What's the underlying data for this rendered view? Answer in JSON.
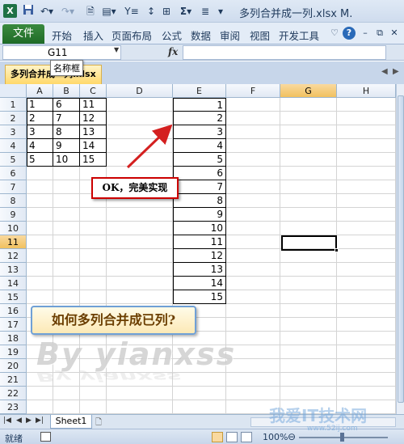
{
  "title_bar": {
    "app_icon": "X",
    "save_icon": "save-icon",
    "undo_icon": "undo-icon",
    "redo_icon": "redo-icon",
    "title": "多列合并成一列.xlsx M."
  },
  "ribbon": {
    "file_tab": "文件",
    "tabs": [
      "开始",
      "插入",
      "页面布局",
      "公式",
      "数据",
      "审阅",
      "视图",
      "开发工具"
    ],
    "help_icon": "?"
  },
  "formula_bar": {
    "name_box_value": "G11",
    "fx_label": "fx",
    "formula_value": "",
    "tooltip": "名称框"
  },
  "workbook_tab": {
    "name": "多列合并成一列.xlsx"
  },
  "grid": {
    "columns": [
      "A",
      "B",
      "C",
      "D",
      "E",
      "F",
      "G",
      "H"
    ],
    "rows": [
      "1",
      "2",
      "3",
      "4",
      "5",
      "6",
      "7",
      "8",
      "9",
      "10",
      "11",
      "12",
      "13",
      "14",
      "15",
      "16",
      "17",
      "18",
      "19",
      "20",
      "21",
      "22",
      "23"
    ],
    "active_cell": "G11",
    "table_abc": [
      [
        "1",
        "6",
        "11"
      ],
      [
        "2",
        "7",
        "12"
      ],
      [
        "3",
        "8",
        "13"
      ],
      [
        "4",
        "9",
        "14"
      ],
      [
        "5",
        "10",
        "15"
      ]
    ],
    "column_e": [
      "1",
      "2",
      "3",
      "4",
      "5",
      "6",
      "7",
      "8",
      "9",
      "10",
      "11",
      "12",
      "13",
      "14",
      "15"
    ]
  },
  "annotations": {
    "ok_callout": "OK，完美实现",
    "question_callout": "如何多列合并成已列?",
    "watermark": "By yianxss",
    "site_watermark": "我爱IT技术网",
    "site_watermark_sub": "www.52ij.com"
  },
  "sheets": {
    "tabs": [
      "Sheet1"
    ]
  },
  "status_bar": {
    "status": "就绪",
    "zoom": "100%"
  },
  "colors": {
    "file_tab": "#1f6b27",
    "active_header": "#f1c15f",
    "callout_border": "#c00000",
    "arrow": "#d42020"
  }
}
